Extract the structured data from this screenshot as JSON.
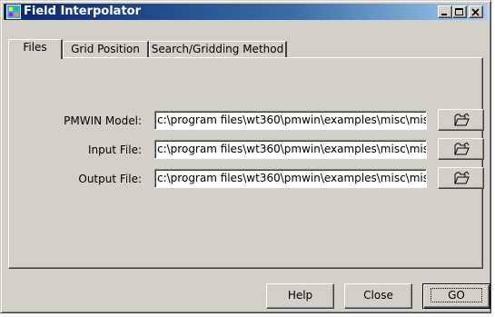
{
  "window": {
    "title": "Field Interpolator"
  },
  "tabs": [
    {
      "label": "Files",
      "active": true
    },
    {
      "label": "Grid Position",
      "active": false
    },
    {
      "label": "Search/Gridding Method",
      "active": false
    }
  ],
  "files": {
    "pmwin_model": {
      "label": "PMWIN Model:",
      "value": "c:\\program files\\wt360\\pmwin\\examples\\misc\\mis"
    },
    "input_file": {
      "label": "Input File:",
      "value": "c:\\program files\\wt360\\pmwin\\examples\\misc\\mis"
    },
    "output_file": {
      "label": "Output File:",
      "value": "c:\\program files\\wt360\\pmwin\\examples\\misc\\mis"
    }
  },
  "buttons": {
    "help": "Help",
    "close": "Close",
    "go": "GO"
  },
  "icons": {
    "app": "field-interpolator-icon",
    "browse": "open-folder-icon"
  },
  "colors": {
    "title_start": "#0a246a",
    "title_end": "#a6caf0",
    "face": "#d4d0c8"
  }
}
